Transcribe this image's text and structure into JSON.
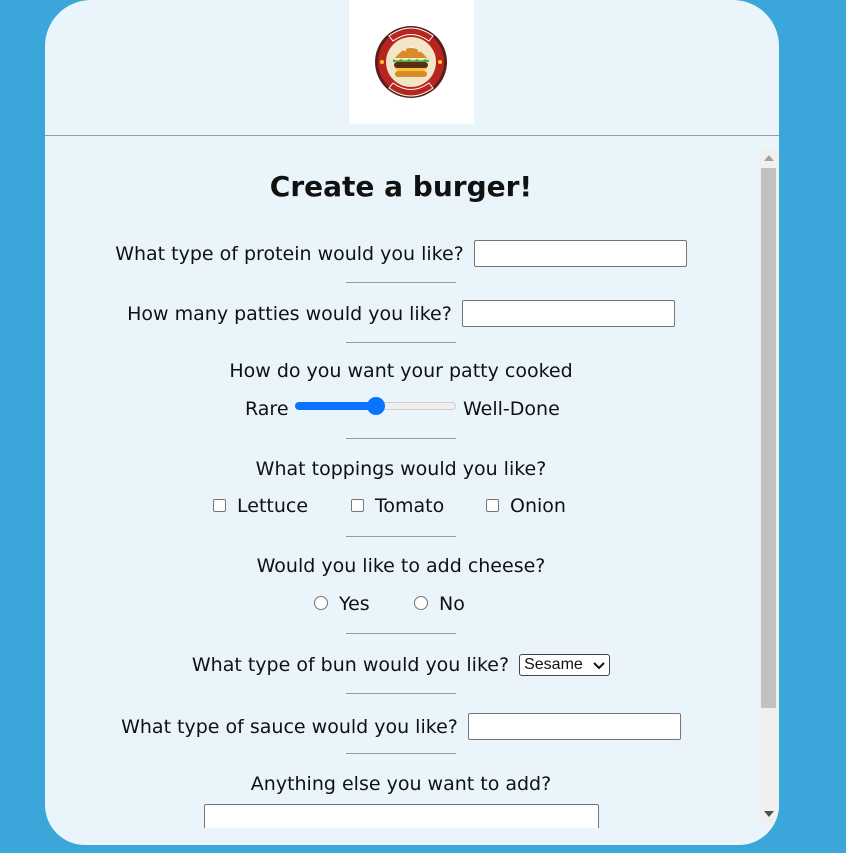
{
  "logo": {
    "top_text": "BURGER",
    "bottom_text": "DAILY FRESH"
  },
  "form": {
    "title": "Create a burger!",
    "protein": {
      "label": "What type of protein would you like?",
      "value": ""
    },
    "patties": {
      "label": "How many patties would you like?",
      "value": ""
    },
    "cooked": {
      "label": "How do you want your patty cooked",
      "min_label": "Rare",
      "max_label": "Well-Done",
      "level": 0.5
    },
    "toppings": {
      "label": "What toppings would you like?",
      "options": [
        "Lettuce",
        "Tomato",
        "Onion"
      ]
    },
    "cheese": {
      "label": "Would you like to add cheese?",
      "options": [
        "Yes",
        "No"
      ]
    },
    "bun": {
      "label": "What type of bun would you like?",
      "selected": "Sesame"
    },
    "sauce": {
      "label": "What type of sauce would you like?",
      "value": ""
    },
    "extra": {
      "label": "Anything else you want to add?",
      "value": ""
    }
  },
  "colors": {
    "background": "#3aa6d9",
    "card": "#e9f5fa",
    "accent": "#0a74ff"
  },
  "icons": [
    "burger-logo",
    "chevron-down-icon"
  ]
}
